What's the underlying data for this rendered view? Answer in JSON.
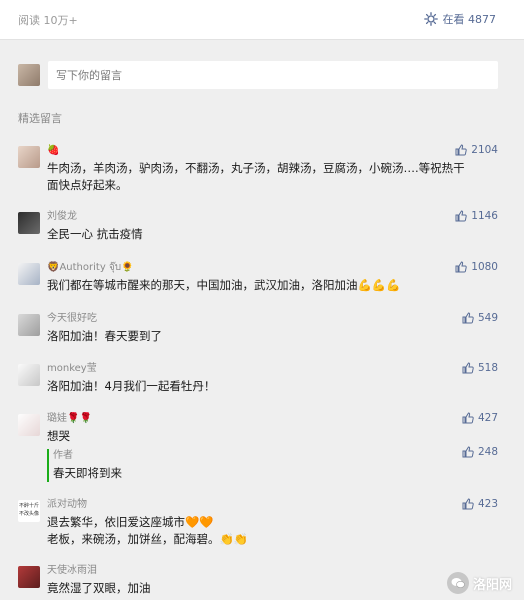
{
  "header": {
    "reads": "阅读 10万+",
    "watching": "在看 4877",
    "watching_icon": "sparkle-icon"
  },
  "composer": {
    "placeholder": "写下你的留言"
  },
  "section_title": "精选留言",
  "comments": [
    {
      "nick": "🍓",
      "content": "牛肉汤，羊肉汤，驴肉汤，不翻汤，丸子汤，胡辣汤，豆腐汤，小碗汤….等祝热干面快点好起来。",
      "likes": "2104"
    },
    {
      "nick": "刘俊龙",
      "content": "全民一心 抗击疫情",
      "likes": "1146"
    },
    {
      "nick": "🦁Authority จุ๊บ🌻",
      "content": "我们都在等城市醒来的那天，中国加油，武汉加油，洛阳加油💪💪💪",
      "likes": "1080"
    },
    {
      "nick": "今天很好吃",
      "content": "洛阳加油！春天要到了",
      "likes": "549"
    },
    {
      "nick": "monkey莹",
      "content": "洛阳加油！4月我们一起看牡丹！",
      "likes": "518"
    },
    {
      "nick": "璐娃🌹🌹",
      "content": "想哭",
      "likes": "427",
      "reply": {
        "author_label": "作者",
        "content": "春天即将到来",
        "likes": "248"
      }
    },
    {
      "nick": "派对动物",
      "avatar_text": [
        "不醉十斤",
        "不改头像"
      ],
      "content": "退去繁华，依旧爱这座城市🧡🧡",
      "content2": "老板，来碗汤，加饼丝，配海碧。👏👏",
      "likes": "423"
    },
    {
      "nick": "天使冰雨泪",
      "content": "竟然湿了双眼，加油",
      "likes": ""
    }
  ],
  "watermark": {
    "text": "洛阳网",
    "icon": "wechat-icon"
  },
  "colors": {
    "accent": "#576b95",
    "author_bar": "#1aad19",
    "background": "#efefef"
  }
}
